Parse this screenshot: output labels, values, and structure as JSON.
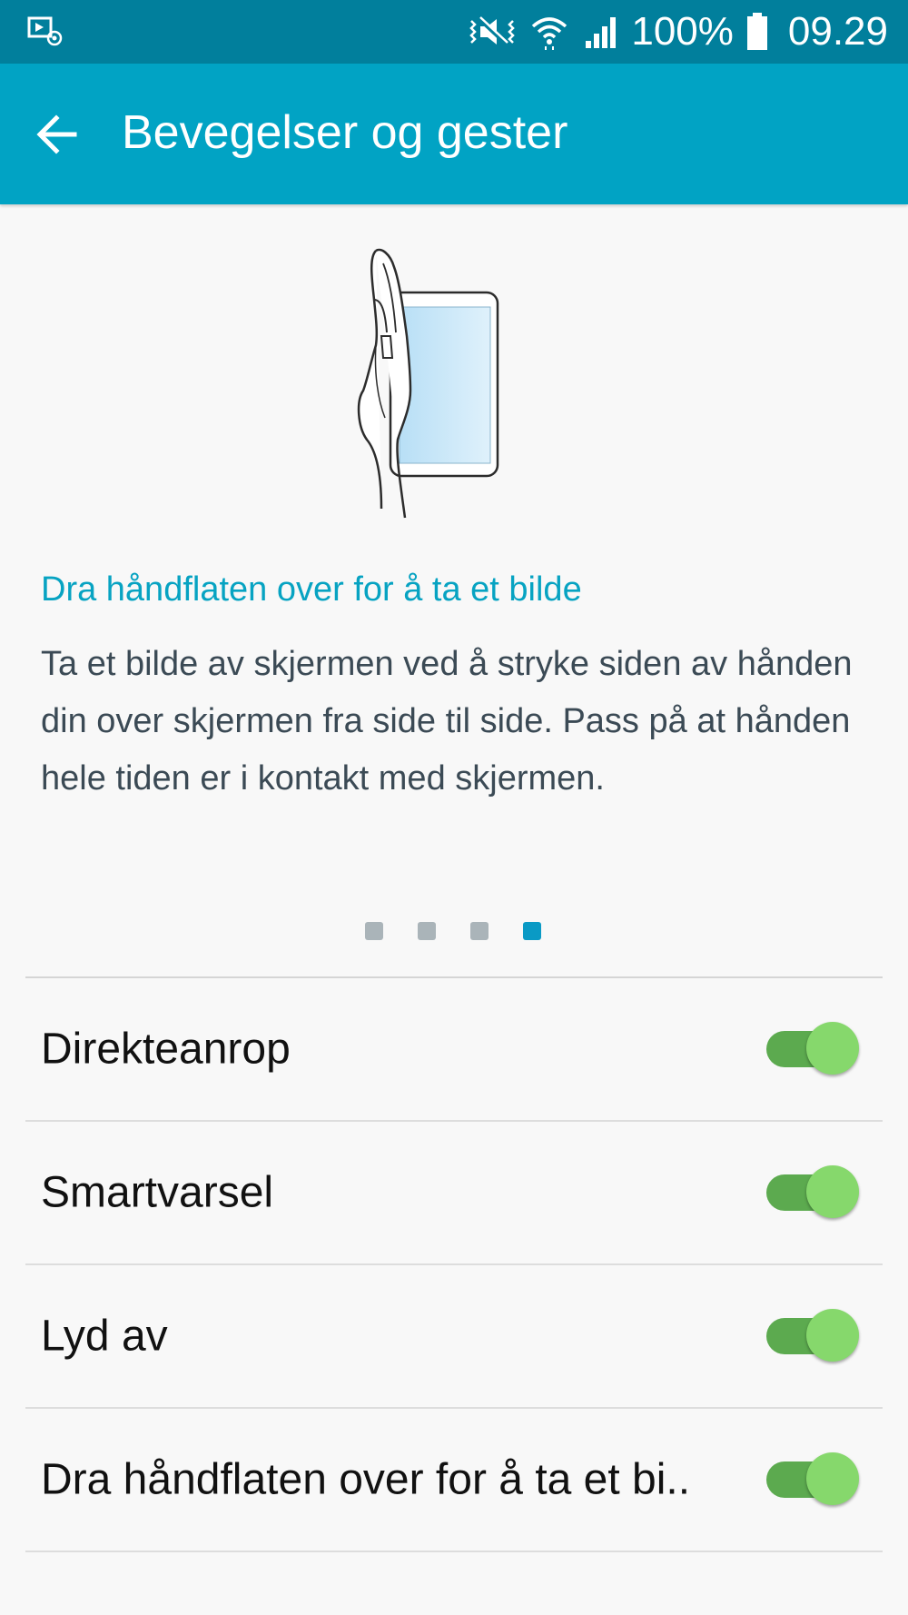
{
  "status_bar": {
    "battery": "100%",
    "time": "09.29",
    "icons": [
      "screen-capture-icon",
      "vibrate-mode-icon",
      "wifi-icon",
      "signal-icon",
      "battery-icon"
    ]
  },
  "app_bar": {
    "title": "Bevegelser og gester",
    "back_icon": "arrow-left-icon"
  },
  "feature": {
    "title": "Dra håndflaten over for å ta et bilde",
    "description": "Ta et bilde av skjermen ved å stryke siden av hånden din over skjermen fra side til side. Pass på at hånden hele tiden er i kontakt med skjermen."
  },
  "pager": {
    "count": 4,
    "active_index": 4
  },
  "settings": [
    {
      "label": "Direkteanrop",
      "enabled": true
    },
    {
      "label": "Smartvarsel",
      "enabled": true
    },
    {
      "label": "Lyd av",
      "enabled": true
    },
    {
      "label": "Dra håndflaten over for å ta et bi..",
      "enabled": true
    }
  ],
  "colors": {
    "status_bar": "#017f9c",
    "app_bar": "#01a3c4",
    "accent_text": "#07a3c2",
    "toggle_on": "#86d86c"
  }
}
